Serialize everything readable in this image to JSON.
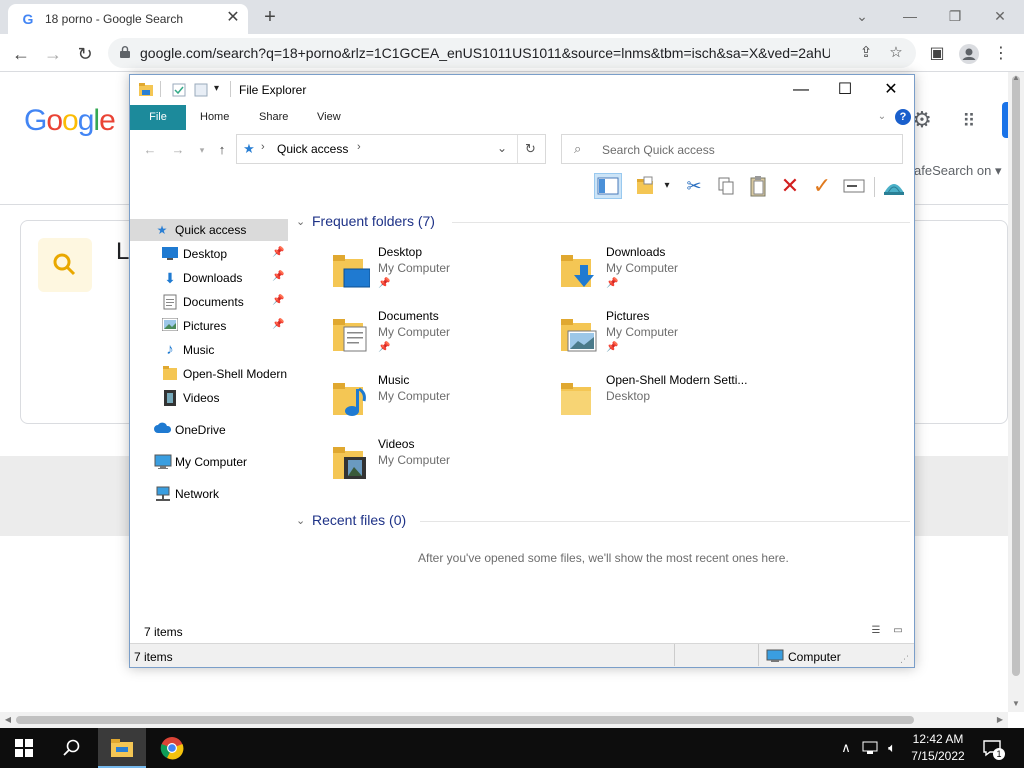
{
  "browser": {
    "tab_title": "18 porno - Google Search",
    "tab_favicon": "G",
    "url": "google.com/search?q=18+porno&rlz=1C1GCEA_enUS1011US1011&source=lnms&tbm=isch&sa=X&ved=2ahU...",
    "new_tab_glyph": "+",
    "close_glyph": "✕"
  },
  "google": {
    "logo_letters": [
      "G",
      "o",
      "o",
      "g",
      "l",
      "e"
    ],
    "safesearch": "afeSearch on ▾",
    "heading_fragment": "L"
  },
  "explorer": {
    "title": "File Explorer",
    "ribbon_tabs": [
      "File",
      "Home",
      "Share",
      "View"
    ],
    "help": "?",
    "address": "Quick access",
    "search_placeholder": "Search Quick access",
    "nav": {
      "quick_access": "Quick access",
      "items": [
        "Desktop",
        "Downloads",
        "Documents",
        "Pictures",
        "Music",
        "Open-Shell Modern",
        "Videos"
      ],
      "onedrive": "OneDrive",
      "my_computer": "My Computer",
      "network": "Network"
    },
    "frequent_header": "Frequent folders (7)",
    "folders": [
      {
        "name": "Desktop",
        "location": "My Computer",
        "pinned": true
      },
      {
        "name": "Downloads",
        "location": "My Computer",
        "pinned": true
      },
      {
        "name": "Documents",
        "location": "My Computer",
        "pinned": true
      },
      {
        "name": "Pictures",
        "location": "My Computer",
        "pinned": true
      },
      {
        "name": "Music",
        "location": "My Computer",
        "pinned": false
      },
      {
        "name": "Open-Shell Modern Setti...",
        "location": "Desktop",
        "pinned": false
      },
      {
        "name": "Videos",
        "location": "My Computer",
        "pinned": false
      }
    ],
    "recent_header": "Recent files (0)",
    "recent_message": "After you've opened some files, we'll show the most recent ones here.",
    "status_count": "7 items",
    "status_bar_count": "7 items",
    "status_bar_location": "Computer"
  },
  "taskbar": {
    "time": "12:42 AM",
    "date": "7/15/2022",
    "notification_count": "1"
  },
  "colors": {
    "ribbon_file": "#1c8a9b",
    "folder_yellow": "#f4c654",
    "accent_blue": "#1a73e8"
  }
}
